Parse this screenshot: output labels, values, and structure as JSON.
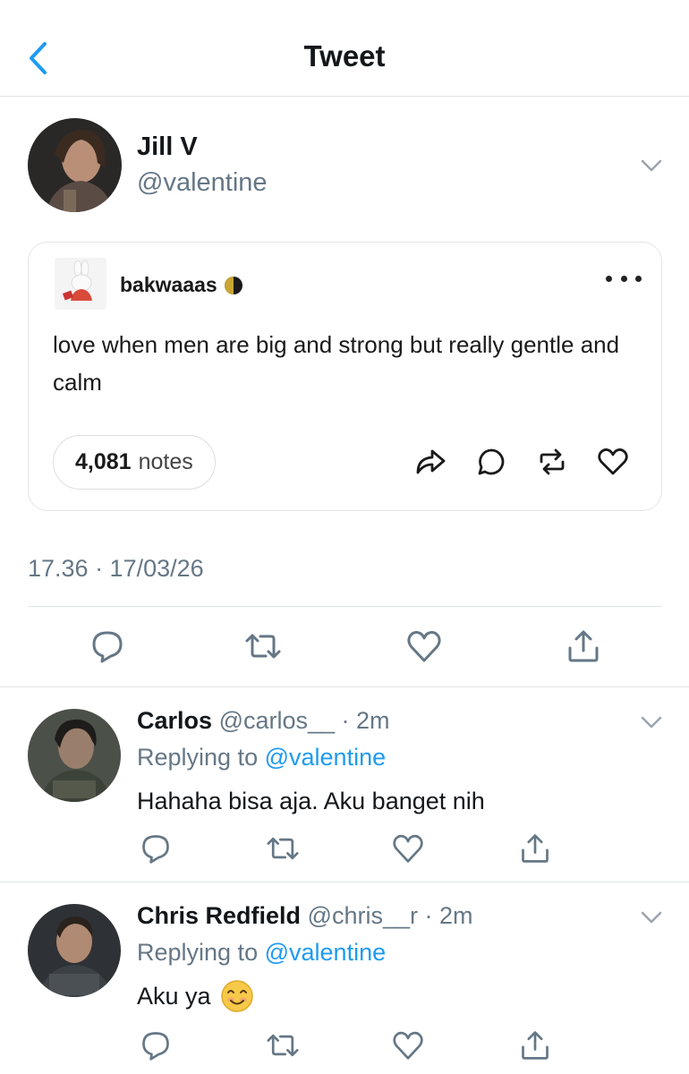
{
  "header": {
    "title": "Tweet",
    "back_icon": "chevron-left-icon"
  },
  "tweet": {
    "author_name": "Jill V",
    "author_handle": "@valentine",
    "embed": {
      "username": "bakwaaas",
      "text": "love when men are big and strong but really gentle and calm",
      "notes_count": "4,081",
      "notes_label": "notes"
    },
    "timestamp": "17.36 · 17/03/26"
  },
  "replies": [
    {
      "name": "Carlos",
      "handle_time": "@carlos__ · 2m",
      "replying_prefix": "Replying to",
      "replying_to": "@valentine",
      "text": "Hahaha bisa aja. Aku banget nih"
    },
    {
      "name": "Chris Redfield",
      "handle_time": "@chris__r · 2m",
      "replying_prefix": "Replying to",
      "replying_to": "@valentine",
      "text": "Aku ya",
      "emoji": "smiling-face-emoji"
    }
  ],
  "colors": {
    "accent": "#1d9bf0",
    "secondary_text": "#657786",
    "divider": "#e1e5e8"
  }
}
